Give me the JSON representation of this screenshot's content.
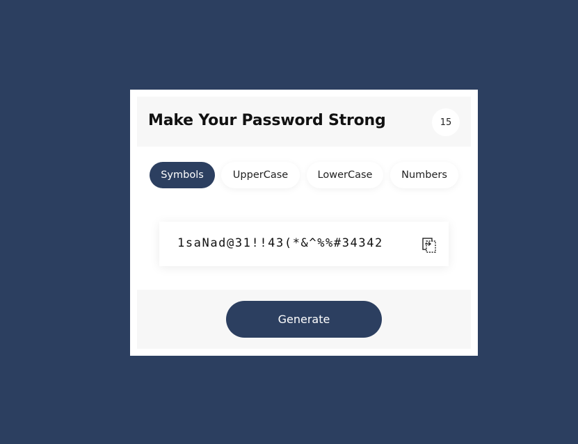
{
  "header": {
    "title": "Make Your Password Strong",
    "length": "15"
  },
  "options": [
    {
      "label": "Symbols",
      "active": true
    },
    {
      "label": "UpperCase",
      "active": false
    },
    {
      "label": "LowerCase",
      "active": false
    },
    {
      "label": "Numbers",
      "active": false
    }
  ],
  "output": {
    "password": "1saNad@31!!43(*&^%%#34342",
    "copy_icon": "copy-icon"
  },
  "footer": {
    "generate_label": "Generate"
  },
  "colors": {
    "background": "#2c3f60",
    "accent": "#2c3f60",
    "panel": "#f7f7f7",
    "card": "#ffffff"
  }
}
